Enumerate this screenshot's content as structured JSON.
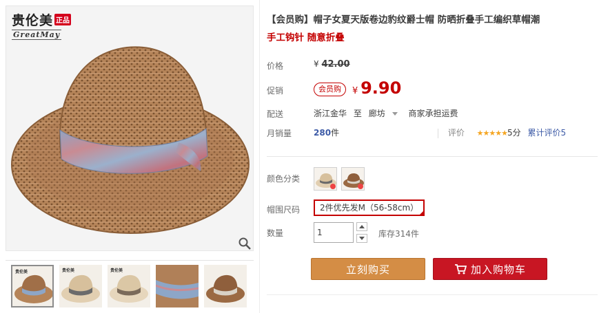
{
  "brand": {
    "name": "贵伦美",
    "badge": "正品",
    "sub": "GreatMay"
  },
  "gallery": {
    "zoom_icon": "magnifier-icon",
    "thumbnails": [
      {
        "label": "thumb-1",
        "selected": true
      },
      {
        "label": "thumb-2",
        "selected": false
      },
      {
        "label": "thumb-3",
        "selected": false
      },
      {
        "label": "thumb-4",
        "selected": false
      },
      {
        "label": "thumb-5",
        "selected": false
      }
    ],
    "thumb_logo": "贵伦美"
  },
  "product": {
    "title": "【会员购】帽子女夏天版卷边豹纹爵士帽 防晒折叠手工编织草帽潮",
    "subtitle": "手工钩针 随意折叠"
  },
  "labels": {
    "price": "价格",
    "promo": "促销",
    "shipping": "配送",
    "monthly_sales": "月销量",
    "color": "颜色分类",
    "size": "帽围尺码",
    "quantity": "数量"
  },
  "price": {
    "currency": "¥",
    "original": "42.00",
    "promo_tag": "会员购",
    "promo": "9.90"
  },
  "shipping": {
    "from": "浙江金华",
    "to_word": "至",
    "dest": "廊坊",
    "fee": "商家承担运费"
  },
  "sales": {
    "count": "280",
    "unit": "件"
  },
  "rating": {
    "label": "评价",
    "stars": "★★★★★",
    "score": "5分",
    "reviews": "累计评价5"
  },
  "options": {
    "size_selected": "2件优先发M（56-58cm）"
  },
  "quantity": {
    "value": "1",
    "stock": "库存314件"
  },
  "buttons": {
    "buy": "立刻购买",
    "cart": "加入购物车",
    "cart_icon": "shopping-cart-icon"
  },
  "colors": {
    "accent_red": "#c40000",
    "buy_orange": "#d48d45",
    "cart_red": "#c81623",
    "hat_brown": "#b08058"
  }
}
